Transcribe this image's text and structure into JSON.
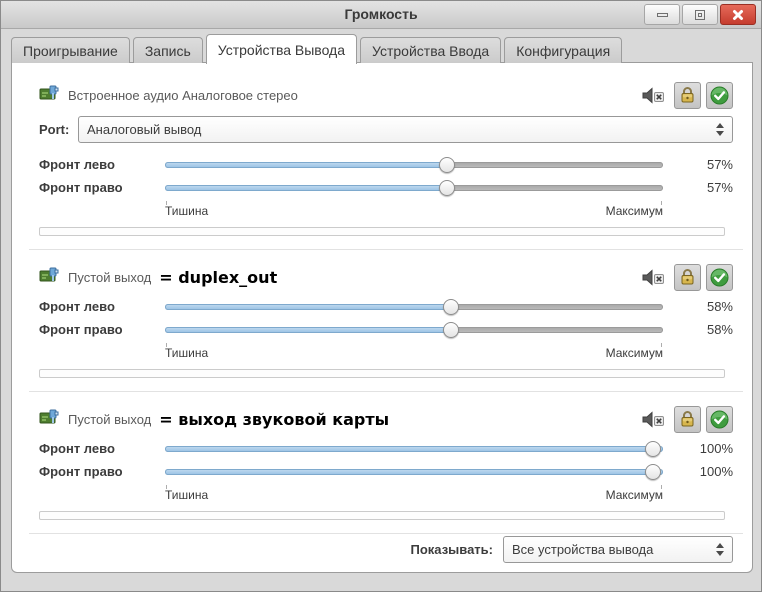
{
  "window": {
    "title": "Громкость"
  },
  "titlebar": {
    "minimize_icon": "minimize-icon",
    "maximize_icon": "maximize-icon",
    "close_icon": "close-icon"
  },
  "tabs": [
    {
      "label": "Проигрывание",
      "active": false
    },
    {
      "label": "Запись",
      "active": false
    },
    {
      "label": "Устройства Вывода",
      "active": true
    },
    {
      "label": "Устройства Ввода",
      "active": false
    },
    {
      "label": "Конфигурация",
      "active": false
    }
  ],
  "devices": [
    {
      "name": "Встроенное аудио Аналоговое стерео",
      "annotation": "",
      "icon": "sound-card-icon",
      "actions": {
        "mute": "muted-speaker-icon",
        "lock": "lock-channels-icon",
        "set_default": "default-device-check-icon"
      },
      "port": {
        "label": "Port:",
        "value": "Аналоговый вывод"
      },
      "channels": [
        {
          "label": "Фронт лево",
          "value": 57,
          "percent": "57%"
        },
        {
          "label": "Фронт право",
          "value": 57,
          "percent": "57%"
        }
      ],
      "scale": {
        "min": "Тишина",
        "max": "Максимум"
      }
    },
    {
      "name": "Пустой выход",
      "annotation": "= duplex_out",
      "icon": "sound-card-icon",
      "actions": {
        "mute": "muted-speaker-icon",
        "lock": "lock-channels-icon",
        "set_default": "default-device-check-icon"
      },
      "channels": [
        {
          "label": "Фронт лево",
          "value": 58,
          "percent": "58%"
        },
        {
          "label": "Фронт право",
          "value": 58,
          "percent": "58%"
        }
      ],
      "scale": {
        "min": "Тишина",
        "max": "Максимум"
      }
    },
    {
      "name": "Пустой выход",
      "annotation": "= выход звуковой карты",
      "icon": "sound-card-icon",
      "actions": {
        "mute": "muted-speaker-icon",
        "lock": "lock-channels-icon",
        "set_default": "default-device-check-icon"
      },
      "channels": [
        {
          "label": "Фронт лево",
          "value": 100,
          "percent": "100%"
        },
        {
          "label": "Фронт право",
          "value": 100,
          "percent": "100%"
        }
      ],
      "scale": {
        "min": "Тишина",
        "max": "Максимум"
      }
    }
  ],
  "footer": {
    "label": "Показывать:",
    "value": "Все устройства вывода"
  },
  "colors": {
    "slider_fill": "#96c0e4",
    "close_red": "#c53c2e",
    "check_green": "#3f9c3f",
    "lock_gold": "#c9a23a",
    "panel_bg": "#ffffff",
    "window_bg": "#d9d9d9"
  }
}
